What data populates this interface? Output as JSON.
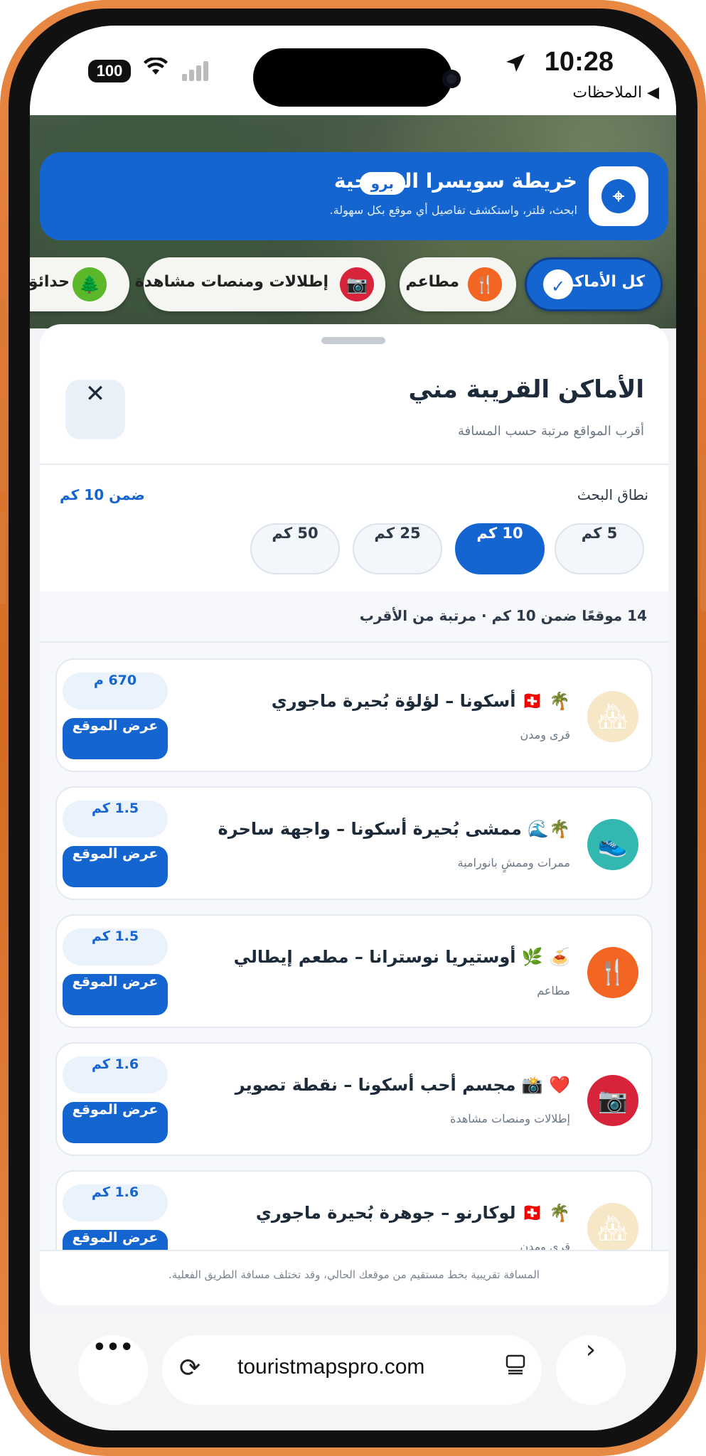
{
  "status": {
    "battery": "100",
    "time": "10:28",
    "back_app": "◀ الملاحظات"
  },
  "banner": {
    "title": "خريطة سويسرا السياحية",
    "badge": "برو",
    "subtitle": "ابحث، فلتر، واستكشف تفاصيل أي موقع بكل سهولة."
  },
  "chips": [
    {
      "label": "كل الأماكن",
      "icon": "check-icon",
      "active": true
    },
    {
      "label": "مطاعم",
      "icon": "fork-knife-icon"
    },
    {
      "label": "إطلالات ومنصات مشاهدة",
      "icon": "camera-icon"
    },
    {
      "label": "حدائق",
      "icon": "tree-icon"
    }
  ],
  "sheet": {
    "title": "الأماكن القريبة مني",
    "subtitle": "أقرب المواقع مرتبة حسب المسافة",
    "close": "✕",
    "range_label": "نطاق البحث",
    "range_current": "ضمن 10 كم",
    "ranges": [
      "5 كم",
      "10 كم",
      "25 كم",
      "50 كم"
    ],
    "summary": "14 موقعًا ضمن 10 كم · مرتبة من الأقرب",
    "view_label": "عرض الموقع",
    "footnote": "المسافة تقريبية بخط مستقيم من موقعك الحالي، وقد تختلف مسافة الطريق الفعلية."
  },
  "places": [
    {
      "title": "🌴 🇨🇭 أسكونا – لؤلؤة بُحيرة ماجوري",
      "category": "قرى ومدن",
      "distance": "670 م",
      "icon": "village-icon",
      "color": "#f6e7c7"
    },
    {
      "title": "🌴🌊 ممشى بُحيرة أسكونا – واجهة ساحرة",
      "category": "ممرات وممشٍ بانورامية",
      "distance": "1.5 كم",
      "icon": "hiking-boot-icon",
      "color": "#32b8b0"
    },
    {
      "title": "🍝 🌿 أوستيريا نوسترانا – مطعم إيطالي",
      "category": "مطاعم",
      "distance": "1.5 كم",
      "icon": "fork-knife-icon",
      "color": "#f26522"
    },
    {
      "title": "❤️ 📸 مجسم أحب أسكونا – نقطة تصوير",
      "category": "إطلالات ومنصات مشاهدة",
      "distance": "1.6 كم",
      "icon": "camera-icon",
      "color": "#d8243a"
    },
    {
      "title": "🌴 🇨🇭 لوكارنو – جوهرة بُحيرة ماجوري",
      "category": "قرى ومدن",
      "distance": "1.6 كم",
      "icon": "village-icon",
      "color": "#f6e7c7"
    }
  ],
  "browser": {
    "url": "touristmapspro.com",
    "more": "•••",
    "next": "›"
  }
}
